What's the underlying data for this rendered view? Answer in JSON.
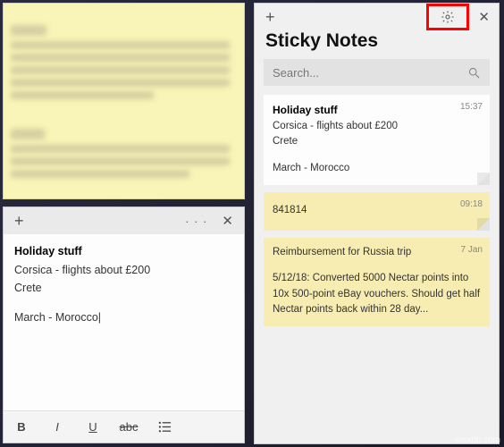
{
  "editor": {
    "plus": "+",
    "menu": "· · ·",
    "close": "✕",
    "title": "Holiday stuff",
    "line1": "Corsica - flights about £200",
    "line2": "Crete",
    "line3": "March - Morocco",
    "format": {
      "bold": "B",
      "italic": "I",
      "underline": "U",
      "strike": "abc"
    }
  },
  "app": {
    "plus": "+",
    "close": "✕",
    "title": "Sticky Notes",
    "search_placeholder": "Search..."
  },
  "notes": [
    {
      "color": "white",
      "time": "15:37",
      "title": "Holiday stuff",
      "lines": [
        "Corsica - flights about £200",
        "Crete",
        "",
        "March - Morocco"
      ]
    },
    {
      "color": "yellow",
      "time": "09:18",
      "title": "",
      "lines": [
        "841814"
      ]
    },
    {
      "color": "yellow",
      "time": "7 Jan",
      "title": "",
      "lines": [
        "Reimbursement for Russia trip",
        "",
        "5/12/18: Converted 5000 Nectar points into 10x 500-point eBay vouchers. Should get half Nectar points back within 28 day..."
      ]
    }
  ],
  "watermark": "wsxdn.com"
}
